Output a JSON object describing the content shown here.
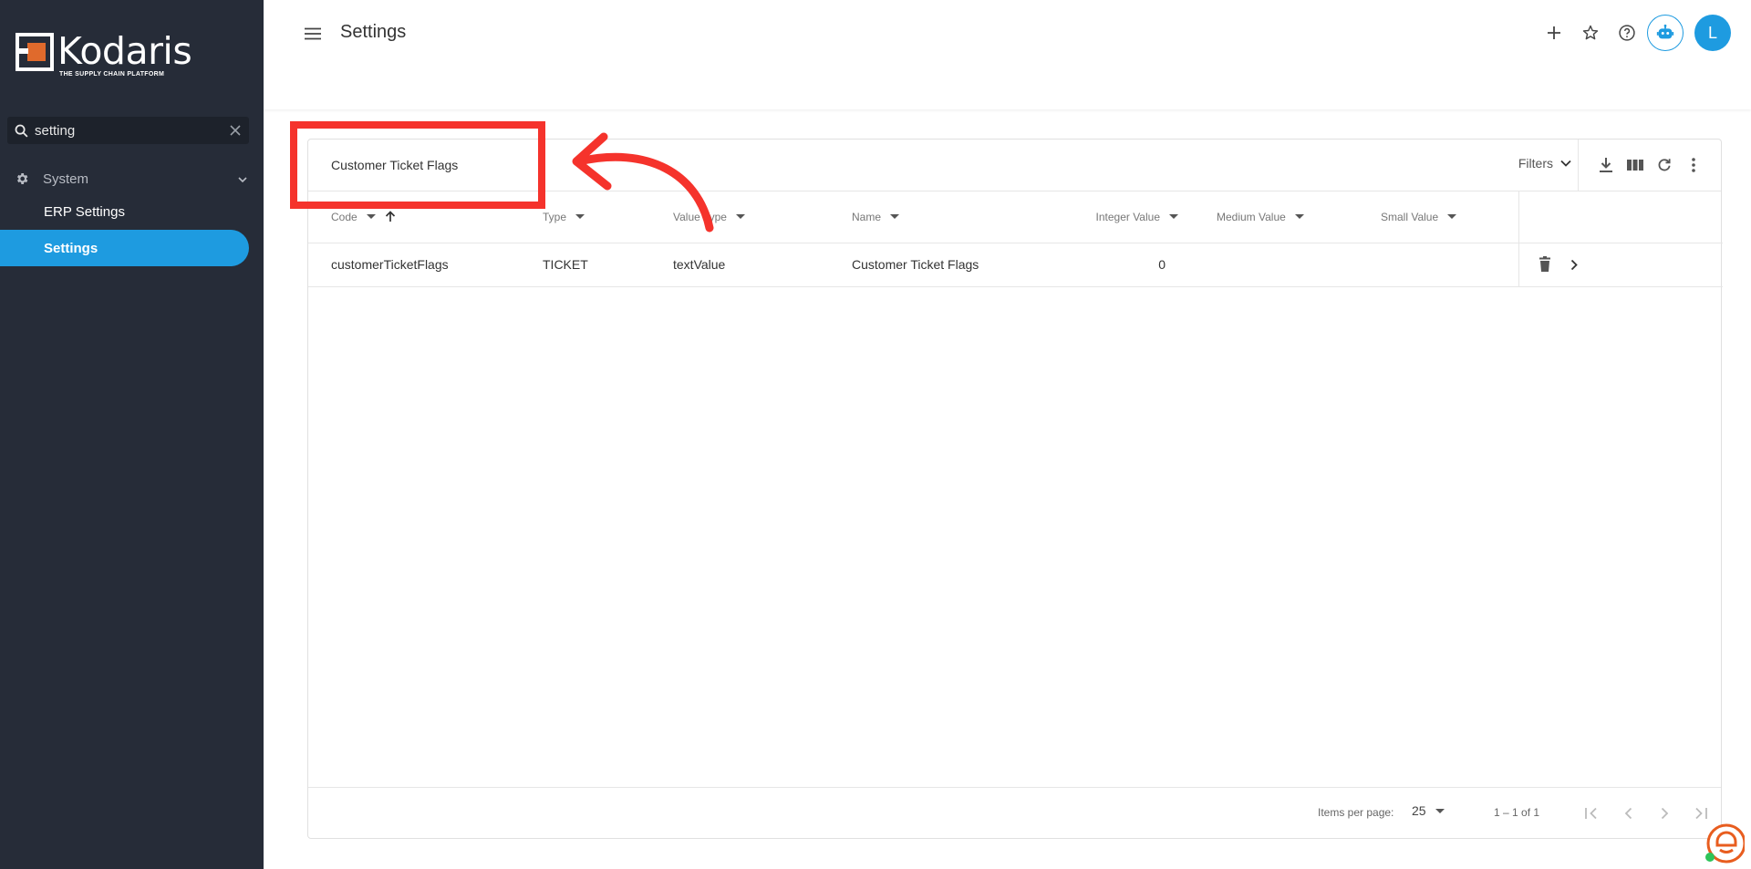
{
  "brand": {
    "name": "Kodaris",
    "tagline": "THE SUPPLY CHAIN PLATFORM",
    "accent": "#1e9be0",
    "mark_color": "#e06a2c"
  },
  "sidebar": {
    "search": {
      "value": "setting",
      "placeholder": ""
    },
    "group": {
      "label": "System",
      "icon": "gear-icon"
    },
    "items": [
      {
        "label": "ERP Settings",
        "active": false
      },
      {
        "label": "Settings",
        "active": true
      }
    ]
  },
  "header": {
    "title": "Settings",
    "icons": [
      "plus-icon",
      "star-icon",
      "help-icon",
      "bot-icon"
    ],
    "avatar_initial": "L"
  },
  "card": {
    "title": "Customer Ticket Flags",
    "filters_label": "Filters",
    "tools": [
      "download-icon",
      "columns-icon",
      "refresh-icon",
      "more-vert-icon"
    ]
  },
  "table": {
    "columns": [
      "Code",
      "Type",
      "Value Type",
      "Name",
      "Integer Value",
      "Medium Value",
      "Small Value"
    ],
    "sort": {
      "column": "Code",
      "direction": "asc"
    },
    "rows": [
      {
        "code": "customerTicketFlags",
        "type": "TICKET",
        "value_type": "textValue",
        "name": "Customer Ticket Flags",
        "integer_value": "0",
        "medium_value": "",
        "small_value": ""
      }
    ]
  },
  "paginator": {
    "items_per_page_label": "Items per page:",
    "page_size": "25",
    "range": "1 – 1 of 1"
  },
  "annotation": {
    "color": "#f5332c"
  }
}
